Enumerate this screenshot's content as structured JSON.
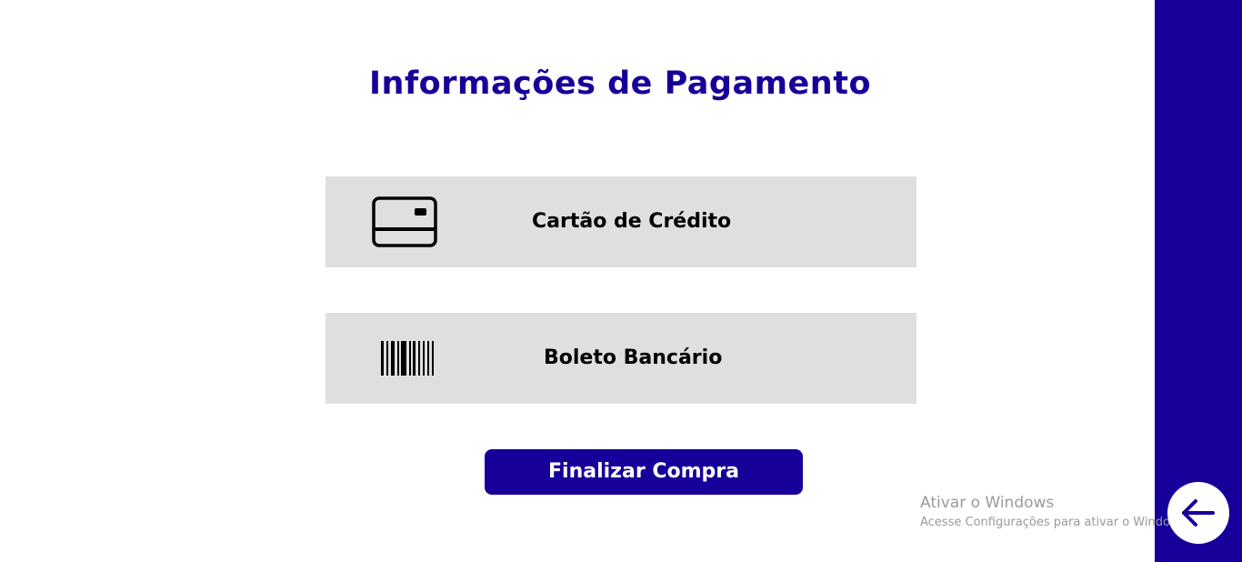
{
  "page": {
    "title": "Informações de Pagamento"
  },
  "payment_options": [
    {
      "label": "Cartão de Crédito",
      "icon": "credit-card-icon"
    },
    {
      "label": "Boleto Bancário",
      "icon": "barcode-icon"
    }
  ],
  "actions": {
    "finalize_label": "Finalizar Compra",
    "back_icon": "arrow-left-icon"
  },
  "watermark": {
    "title": "Ativar o Windows",
    "subtitle": "Acesse Configurações para ativar o Windows."
  },
  "colors": {
    "accent": "#170099",
    "option_bg": "#e0dfdd",
    "background": "#ffffff"
  }
}
